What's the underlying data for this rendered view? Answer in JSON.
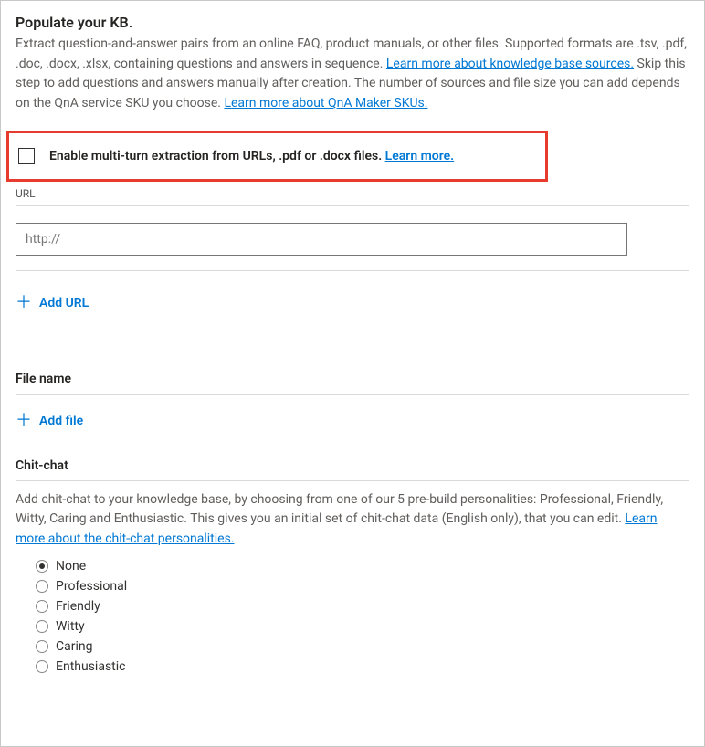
{
  "header": {
    "title": "Populate your KB.",
    "desc_1": "Extract question-and-answer pairs from an online FAQ, product manuals, or other files. Supported formats are .tsv, .pdf, .doc, .docx, .xlsx, containing questions and answers in sequence. ",
    "learn_sources": "Learn more about knowledge base sources.",
    "desc_2": " Skip this step to add questions and answers manually after creation. The number of sources and file size you can add depends on the QnA service SKU you choose. ",
    "learn_skus": "Learn more about QnA Maker SKUs."
  },
  "multiturn": {
    "label_pre": "Enable multi-turn extraction from URLs, .pdf or .docx files. ",
    "learn_more": "Learn more."
  },
  "url_section": {
    "label": "URL",
    "placeholder": "http://",
    "add_label": "Add URL"
  },
  "file_section": {
    "label": "File name",
    "add_label": "Add file"
  },
  "chitchat": {
    "heading": "Chit-chat",
    "desc_pre": "Add chit-chat to your knowledge base, by choosing from one of our 5 pre-build personalities: Professional, Friendly, Witty, Caring and Enthusiastic. This gives you an initial set of chit-chat data (English only), that you can edit. ",
    "learn_link": "Learn more about the chit-chat personalities.",
    "options": [
      "None",
      "Professional",
      "Friendly",
      "Witty",
      "Caring",
      "Enthusiastic"
    ],
    "selected": "None"
  }
}
